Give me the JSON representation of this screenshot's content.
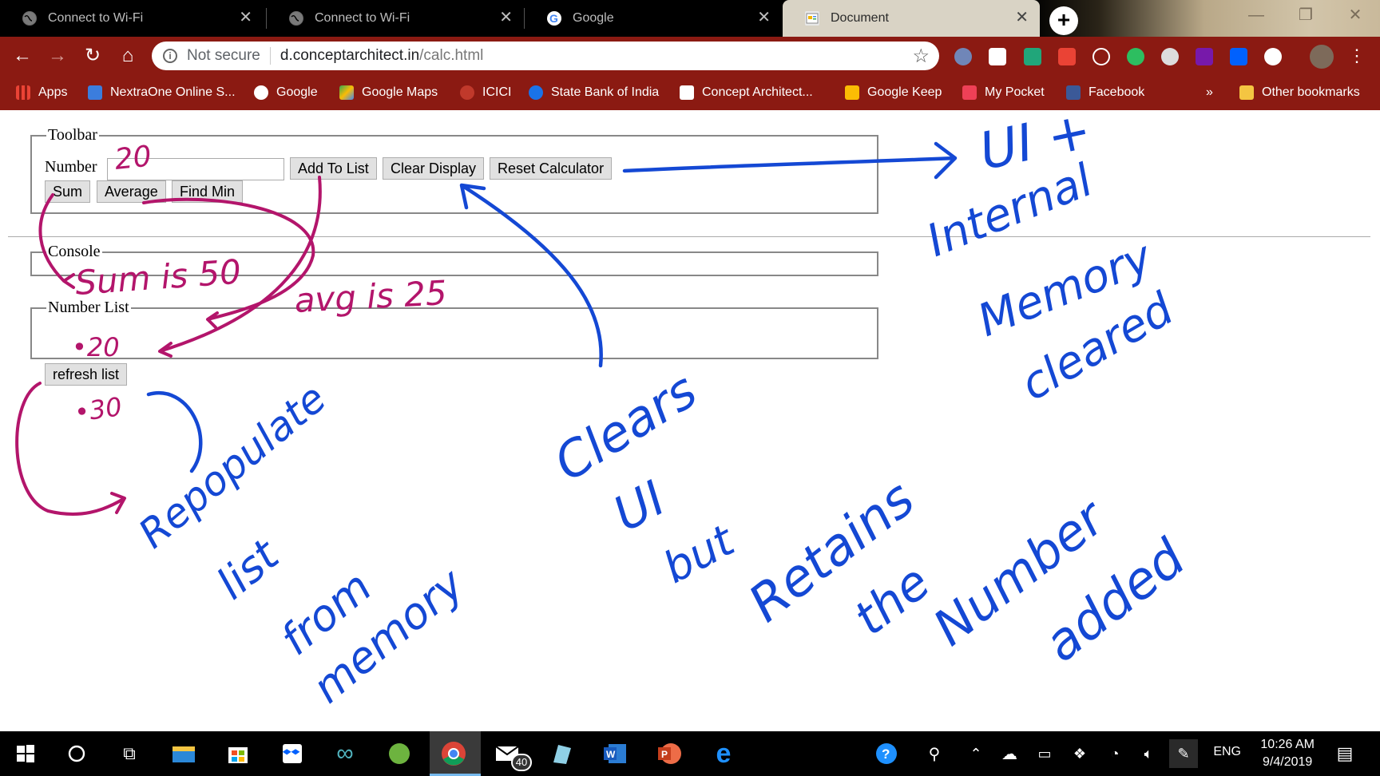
{
  "browser": {
    "tabs": [
      {
        "title": "Connect to Wi-Fi",
        "active": false
      },
      {
        "title": "Connect to Wi-Fi",
        "active": false
      },
      {
        "title": "Google",
        "active": false
      },
      {
        "title": "Document",
        "active": true
      }
    ],
    "address": {
      "security_label": "Not secure",
      "domain": "d.conceptarchitect.in",
      "path": "/calc.html"
    },
    "bookmarks": [
      {
        "label": "Apps",
        "color": "#e94235"
      },
      {
        "label": "NextraOne Online S...",
        "color": "#3b7ddd"
      },
      {
        "label": "Google",
        "color": "#ffffff"
      },
      {
        "label": "Google Maps",
        "color": "#34a853"
      },
      {
        "label": "ICICI",
        "color": "#c0392b"
      },
      {
        "label": "State Bank of India",
        "color": "#1a73e8"
      },
      {
        "label": "Concept Architect...",
        "color": "#ffffff"
      },
      {
        "label": "Google Keep",
        "color": "#fbbc04"
      },
      {
        "label": "My Pocket",
        "color": "#ef4056"
      },
      {
        "label": "Facebook",
        "color": "#3b5998"
      }
    ],
    "bookmarks_overflow": "»",
    "other_bookmarks": "Other bookmarks"
  },
  "page": {
    "toolbar_legend": "Toolbar",
    "number_label": "Number",
    "buttons": {
      "add_to_list": "Add To List",
      "clear_display": "Clear Display",
      "reset_calculator": "Reset Calculator",
      "sum": "Sum",
      "average": "Average",
      "find_min": "Find Min",
      "refresh_list": "refresh list"
    },
    "console_legend": "Console",
    "number_list_legend": "Number List"
  },
  "annotations": {
    "magenta": {
      "input_value": "20",
      "sum_result": "Sum is 50",
      "avg_result": "avg is 25",
      "list_item_1": "•20",
      "list_item_2": "•30",
      "color": "#b3156b"
    },
    "blue": {
      "reset_note_1": "UI +",
      "reset_note_2": "Internal",
      "reset_note_3": "Memory",
      "reset_note_4": "cleared",
      "clear_note_1": "Clears",
      "clear_note_2": "UI",
      "clear_note_3": "but",
      "clear_note_4": "Retains",
      "clear_note_5": "the",
      "clear_note_6": "Number",
      "clear_note_7": "added",
      "refresh_note_1": "Repopulate",
      "refresh_note_2": "list",
      "refresh_note_3": "from",
      "refresh_note_4": "memory",
      "color": "#1448d4"
    }
  },
  "taskbar": {
    "mail_badge": "40",
    "language": "ENG",
    "time": "10:26 AM",
    "date": "9/4/2019"
  }
}
